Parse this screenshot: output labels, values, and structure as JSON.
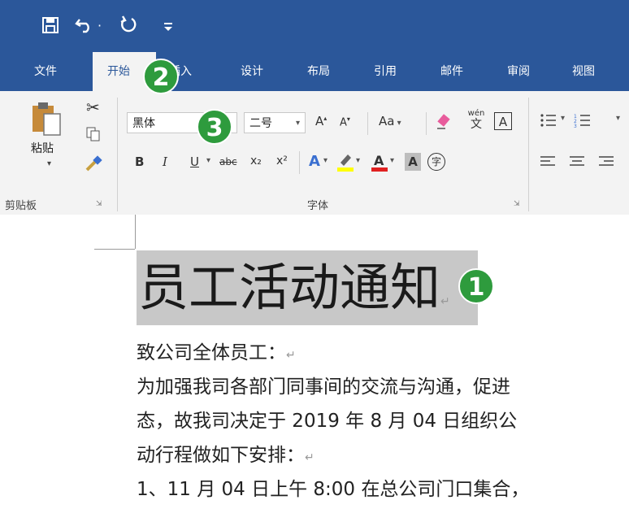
{
  "quick_access": {
    "save_icon": "save-icon",
    "undo_icon": "undo-icon",
    "undo_dropdown": "·",
    "redo_icon": "redo-icon",
    "customize_icon": "customize-icon"
  },
  "tabs": [
    {
      "label": "文件"
    },
    {
      "label": "开始"
    },
    {
      "label": "插入"
    },
    {
      "label": "设计"
    },
    {
      "label": "布局"
    },
    {
      "label": "引用"
    },
    {
      "label": "邮件"
    },
    {
      "label": "审阅"
    },
    {
      "label": "视图"
    }
  ],
  "clipboard": {
    "paste_label": "粘贴",
    "group_label": "剪贴板"
  },
  "font": {
    "font_name": "黑体",
    "font_size": "二号",
    "aa_label": "Aa",
    "bold": "B",
    "italic": "I",
    "underline": "U",
    "strikethrough": "abc",
    "subscript": "x₂",
    "superscript": "x²",
    "phonetic_top": "wén",
    "phonetic_bottom": "文",
    "border_char": "A",
    "shade_char": "A",
    "enclose_char": "字",
    "group_label": "字体"
  },
  "annotations": {
    "badge1": "1",
    "badge2": "2",
    "badge3": "3"
  },
  "document": {
    "title": "员工活动通知",
    "para_mark": "↵",
    "lines": [
      "致公司全体员工：",
      "为加强我司各部门同事间的交流与沟通，促进",
      "态，故我司决定于 2019 年 8 月 04 日组织公",
      "动行程做如下安排：",
      "1、11 月 04 日上午 8:00 在总公司门口集合，"
    ]
  },
  "colors": {
    "accent": "#2b579a",
    "badge": "#2e9b3d",
    "highlight": "#c8c8c8",
    "highlight_yellow": "#ffff00",
    "font_red": "#e02020"
  }
}
